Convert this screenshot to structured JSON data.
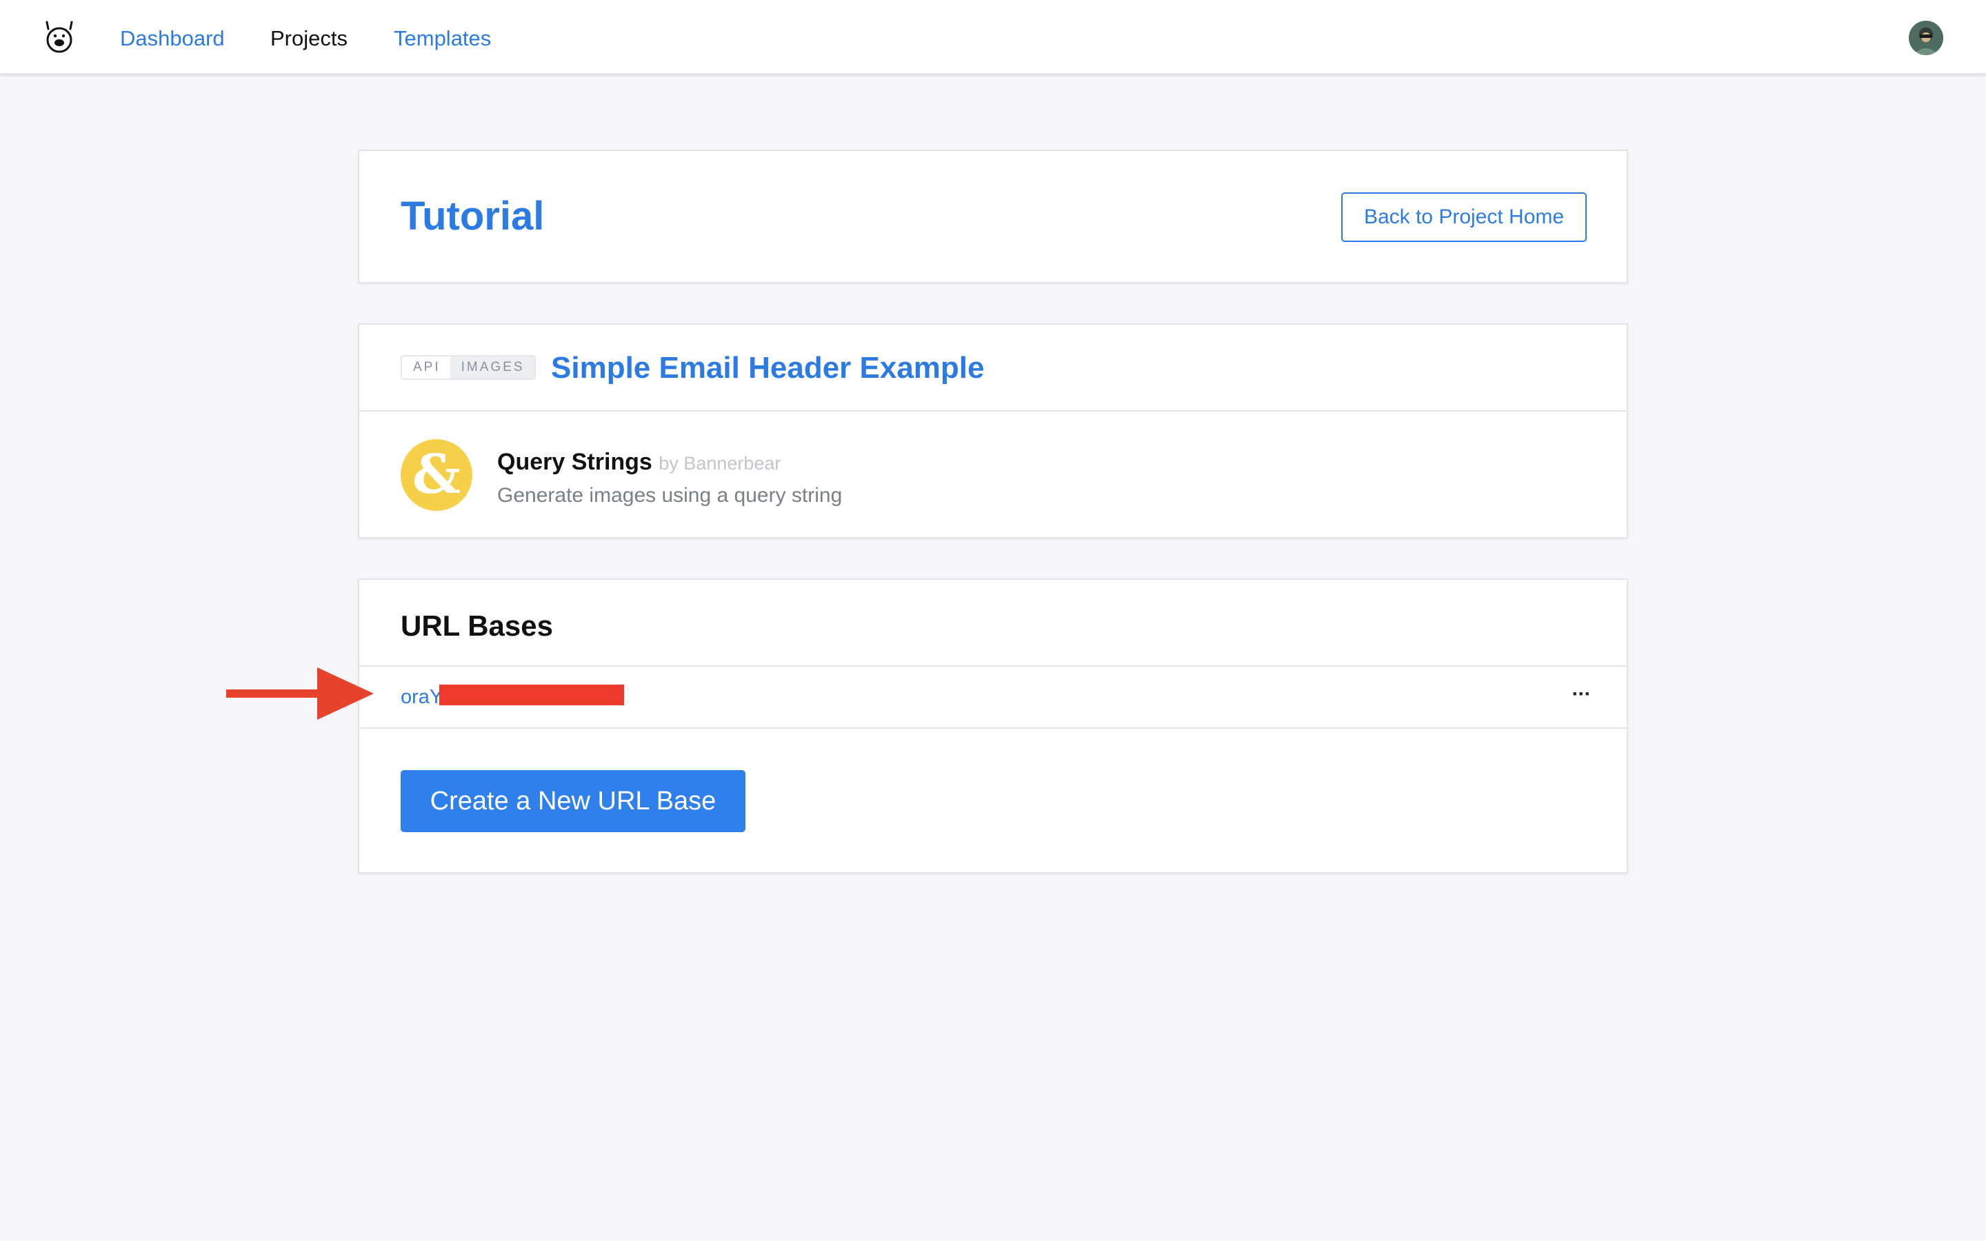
{
  "colors": {
    "accent": "#2c7be5",
    "primary_button": "#2f80ed",
    "integration_icon": "#f7d04a",
    "annotation_arrow": "#e8412c",
    "redaction": "#ee3a2b",
    "nav_active_text": "#111111"
  },
  "nav": {
    "logo_icon": "bear-logo-icon",
    "items": [
      {
        "label": "Dashboard",
        "active": false
      },
      {
        "label": "Projects",
        "active": true
      },
      {
        "label": "Templates",
        "active": false
      }
    ],
    "avatar_icon": "user-avatar-icon"
  },
  "tutorial": {
    "title": "Tutorial",
    "back_button": "Back to Project Home"
  },
  "template": {
    "tags": [
      "API",
      "IMAGES"
    ],
    "title": "Simple Email Header Example",
    "integration": {
      "icon": "ampersand-icon",
      "icon_glyph": "&",
      "name": "Query Strings",
      "by": "by Bannerbear",
      "description": "Generate images using a query string"
    }
  },
  "url_bases": {
    "title": "URL Bases",
    "items": [
      {
        "visible_text": "oraY",
        "redacted": true
      }
    ],
    "more_icon": "more-horizontal-icon",
    "more_glyph": "···",
    "create_button": "Create a New URL Base"
  },
  "annotation": {
    "icon": "red-arrow-icon"
  }
}
